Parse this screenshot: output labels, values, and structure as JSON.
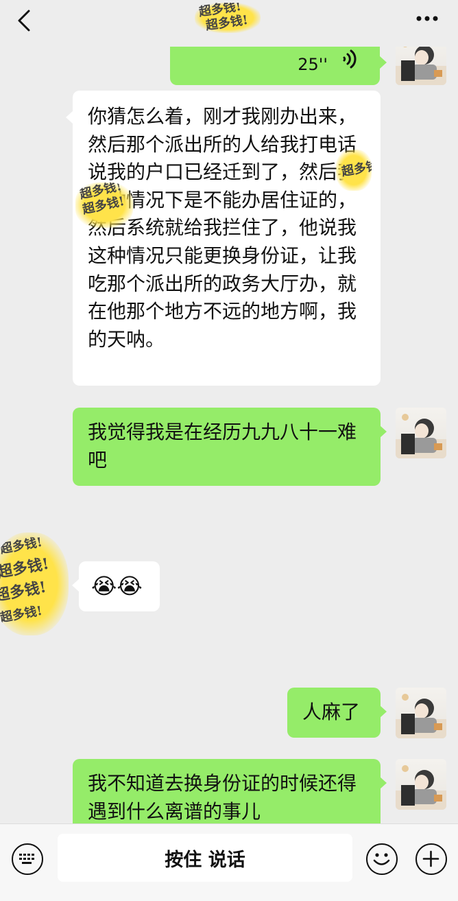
{
  "header": {
    "title": "超多钱!",
    "back_icon": "back-chevron-icon",
    "more_icon": "more-dots-icon"
  },
  "messages": [
    {
      "side": "right",
      "type": "voice",
      "duration": "25''"
    },
    {
      "side": "left",
      "type": "text",
      "text": "你猜怎么着，刚才我刚办出来，然后那个派出所的人给我打电话说我的户口已经迁到了，然后我这种情况下是不能办居住证的，然后系统就给我拦住了，他说我这种情况只能更换身份证，让我吃那个派出所的政务大厅办，就在他那个地方不远的地方啊，我的天呐。"
    },
    {
      "side": "right",
      "type": "text",
      "text": "我觉得我是在经历九九八十一难吧"
    },
    {
      "side": "left",
      "type": "emoji",
      "text": "😭😭"
    },
    {
      "side": "right",
      "type": "text",
      "text": "人麻了"
    },
    {
      "side": "right",
      "type": "text",
      "text": "我不知道去换身份证的时候还得遇到什么离谱的事儿"
    }
  ],
  "redaction_text": "超多钱!",
  "footer": {
    "hold_to_talk": "按住 说话",
    "keyboard_icon": "keyboard-icon",
    "emoji_icon": "emoji-icon",
    "add_icon": "plus-icon"
  },
  "colors": {
    "background": "#ededed",
    "outgoing_bubble": "#95ec69",
    "incoming_bubble": "#ffffff",
    "redaction": "#ffe34a"
  }
}
